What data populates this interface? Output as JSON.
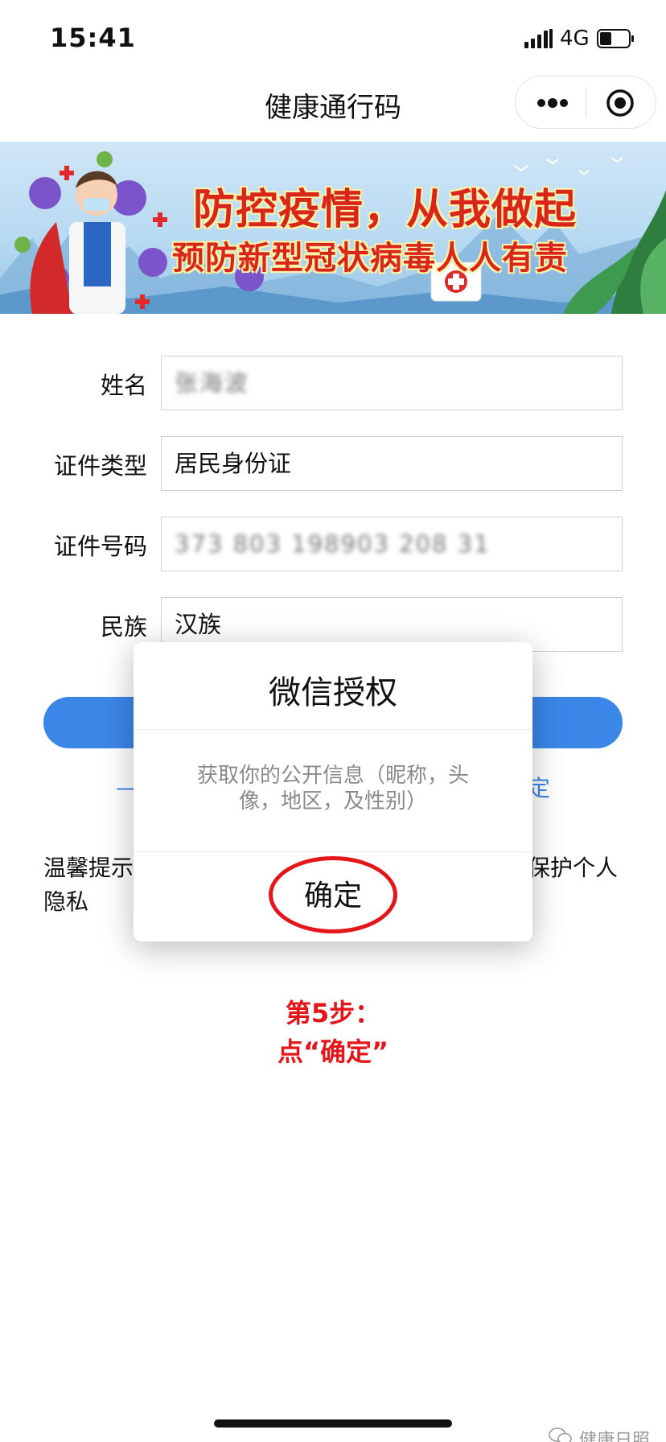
{
  "status_bar": {
    "time": "15:41",
    "network": "4G",
    "icons": [
      "signal-icon",
      "battery-icon"
    ]
  },
  "nav": {
    "title": "健康通行码",
    "icons": [
      "more-icon",
      "target-icon"
    ]
  },
  "banner": {
    "line1": "防控疫情，从我做起",
    "line2": "预防新型冠状病毒人人有责"
  },
  "form": {
    "name_label": "姓名",
    "name_value": "张海波",
    "id_type_label": "证件类型",
    "id_type_value": "居民身份证",
    "id_number_label": "证件号码",
    "id_number_value": "373 803 198903 208 31",
    "ethnicity_label": "民族",
    "ethnicity_value": "汉族"
  },
  "page_partial": {
    "link_left": "—",
    "link_right": "定",
    "tip_left": "温馨提示",
    "tip_left_line2": "隐私",
    "tip_right": "保护个人"
  },
  "dialog": {
    "title": "微信授权",
    "body": "获取你的公开信息（昵称，头像，地区，及性别）",
    "confirm_label": "确定"
  },
  "annotation": {
    "step_line1": "第5步：",
    "step_line2": "点“确定”",
    "color": "#e3161a"
  },
  "watermark": {
    "text": "健康日照"
  },
  "colors": {
    "accent_blue": "#3b87e8",
    "annotation_red": "#e3161a"
  }
}
